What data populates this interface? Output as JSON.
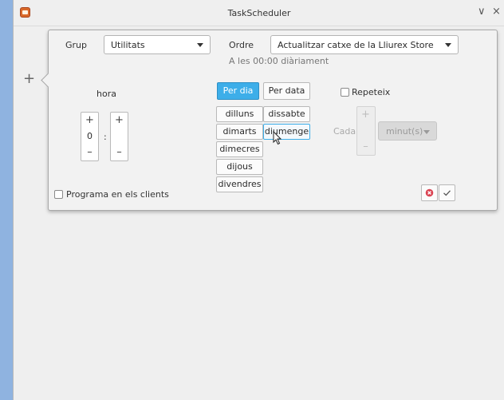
{
  "window": {
    "title": "TaskScheduler",
    "minimize_glyph": "∨",
    "close_glyph": "×",
    "side_plus": "+"
  },
  "form": {
    "group_label": "Grup",
    "group_value": "Utilitats",
    "order_label": "Ordre",
    "order_value": "Actualitzar catxe de la Lliurex Store",
    "schedule_summary": "A les 00:00 diàriament",
    "hour_label": "hora",
    "hour_value": "0",
    "minute_value": "",
    "time_separator": ":",
    "plus_glyph": "+",
    "minus_glyph": "–",
    "mode_buttons": [
      "Per dia",
      "Per data"
    ],
    "days": [
      "dilluns",
      "dissabte",
      "dimarts",
      "diumenge",
      "dimecres",
      "dijous",
      "divendres"
    ],
    "repeat_label": "Repeteix",
    "every_label": "Cada",
    "interval_unit": "minut(s)",
    "clients_label": "Programa en els clients"
  },
  "colors": {
    "accent": "#3daee9",
    "cancel_red": "#da4453",
    "confirm_gray": "#555555"
  },
  "icons": {
    "cancel": "cancel-icon",
    "confirm": "check-icon"
  }
}
